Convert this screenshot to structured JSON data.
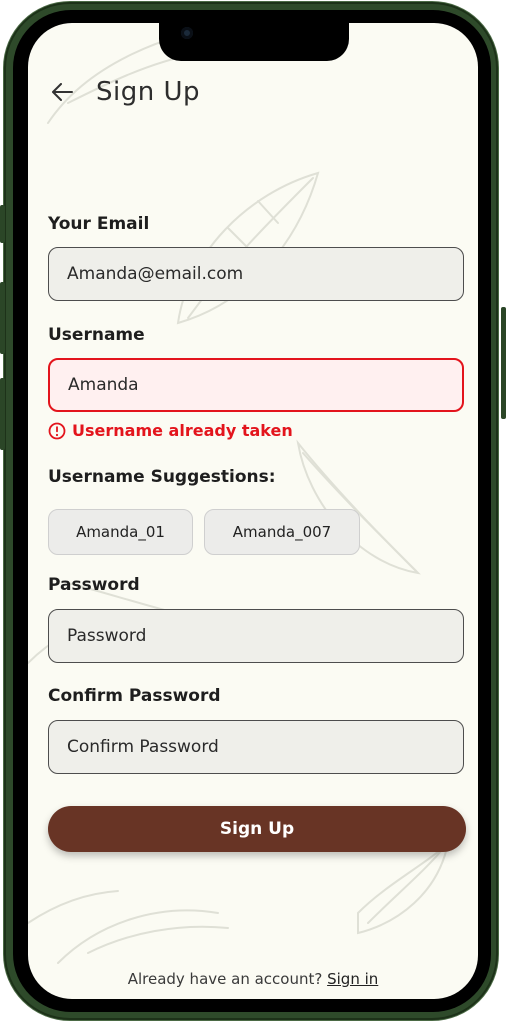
{
  "header": {
    "title": "Sign Up"
  },
  "form": {
    "email": {
      "label": "Your Email",
      "value": "Amanda@email.com"
    },
    "username": {
      "label": "Username",
      "value": "Amanda",
      "error": "Username already taken"
    },
    "suggestions": {
      "label": "Username Suggestions:",
      "items": [
        "Amanda_01",
        "Amanda_007"
      ]
    },
    "password": {
      "label": "Password",
      "placeholder": "Password"
    },
    "confirm_password": {
      "label": "Confirm Password",
      "placeholder": "Confirm Password"
    },
    "submit_label": "Sign Up"
  },
  "footer": {
    "prompt": "Already have an account?",
    "link": "Sign in"
  },
  "colors": {
    "accent": "#683425",
    "error": "#e3141c",
    "background": "#fbfbf3",
    "frame": "#2e4a2a"
  },
  "icons": {
    "back": "arrow-left-icon",
    "error": "error-circle-icon"
  }
}
